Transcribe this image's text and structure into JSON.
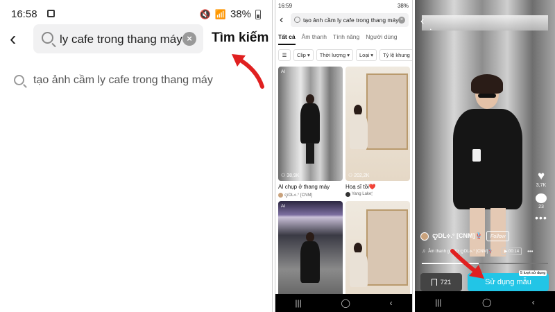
{
  "panel1": {
    "status": {
      "time": "16:58",
      "battery": "38%"
    },
    "search": {
      "query": "ly cafe trong thang máy",
      "button_label": "Tìm kiếm"
    },
    "suggestion": "tạo ảnh cầm ly cafe trong thang máy"
  },
  "panel2": {
    "status": {
      "time": "16:59",
      "battery": "38%"
    },
    "search": {
      "query": "tạo ảnh cầm ly cafe trong thang máy"
    },
    "tabs": [
      "Tất cả",
      "Âm thanh",
      "Tính năng",
      "Người dùng"
    ],
    "filters": [
      "Clip",
      "Thời lượng",
      "Loại",
      "Tỷ lệ khung"
    ],
    "results": [
      {
        "badge": "AI",
        "views": "38,9K",
        "title": "AI chụp ở thang máy",
        "author": "ꨄDL⟡.° [CNM]"
      },
      {
        "badge": "",
        "views": "202,2K",
        "title": "Hoạ sĩ tồi❤️",
        "author": "Yang Lake🕯"
      },
      {
        "badge": "AI",
        "views": "",
        "title": "",
        "author": ""
      },
      {
        "badge": "",
        "views": "",
        "title": "",
        "author": ""
      }
    ]
  },
  "panel3": {
    "side": {
      "likes": "3,7K",
      "comments": "23"
    },
    "author": {
      "name": "ꨄDL⟡.° [CNM]🪢",
      "follow_label": "Follow"
    },
    "sound": {
      "text": "Âm thanh gốc từ ꨄDL⟡.° [CNM]🪢",
      "duration": "00:14"
    },
    "progress": 0.45,
    "save_count": "721",
    "use_button_label": "Sử dụng mẫu",
    "used_badge": "5 lượt sử dụng"
  },
  "colors": {
    "accent": "#22c5e6",
    "arrow": "#e02020"
  }
}
